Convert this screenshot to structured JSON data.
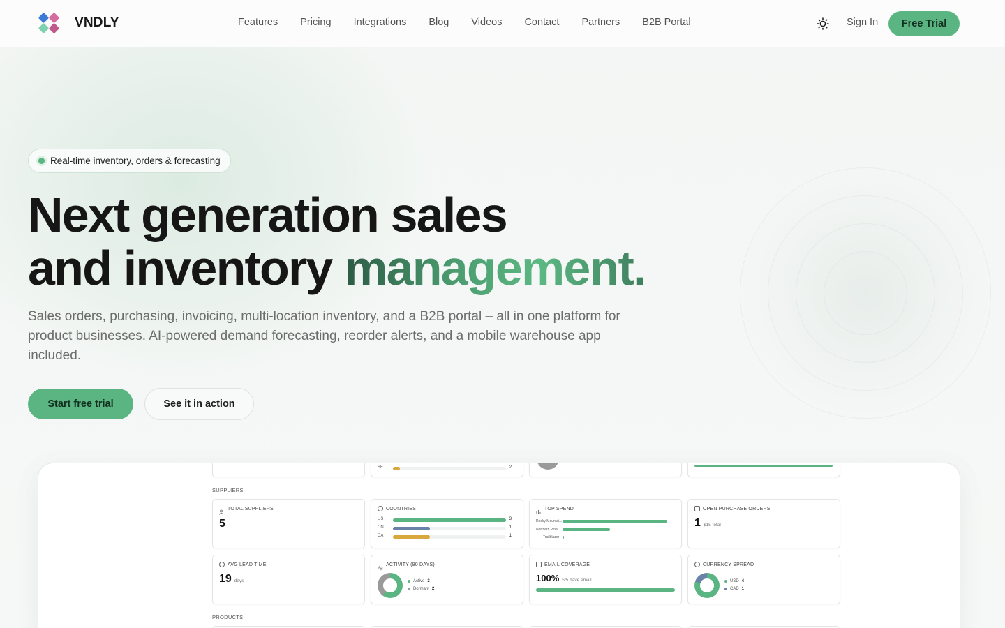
{
  "nav": {
    "brand": "VNDLY",
    "links": [
      "Features",
      "Pricing",
      "Integrations",
      "Blog",
      "Videos",
      "Contact",
      "Partners",
      "B2B Portal"
    ],
    "sign_in": "Sign In",
    "free_trial": "Free Trial",
    "theme_icon": "sun-icon"
  },
  "hero": {
    "badge": "Real-time inventory, orders & forecasting",
    "headline_line1": "Next generation sales",
    "headline_line2_plain": "and inventory ",
    "headline_line2_accent": "management.",
    "subtitle": "Sales orders, purchasing, invoicing, multi-location inventory, and a B2B portal – all in one platform for product businesses. AI-powered demand forecasting, reorder alerts, and a mobile warehouse app included.",
    "cta_primary": "Start free trial",
    "cta_secondary": "See it in action"
  },
  "colors": {
    "accent": "#5bb582",
    "accent_dark": "#2d5a45",
    "bar_blue": "#6b82a8",
    "bar_amber": "#d9a83c",
    "muted_gray": "#9a9a9a"
  },
  "dashboard": {
    "top_partial": {
      "country_row": {
        "label": "SE",
        "value": "2",
        "fraction": 0.06,
        "color": "#d9a83c"
      }
    },
    "suppliers_label": "SUPPLIERS",
    "products_label": "PRODUCTS",
    "total_suppliers": {
      "title": "TOTAL SUPPLIERS",
      "value": "5"
    },
    "countries": {
      "title": "COUNTRIES",
      "rows": [
        {
          "label": "US",
          "value": "3",
          "fraction": 1.0,
          "color": "#5bb582"
        },
        {
          "label": "CN",
          "value": "1",
          "fraction": 0.33,
          "color": "#6b82a8"
        },
        {
          "label": "CA",
          "value": "1",
          "fraction": 0.33,
          "color": "#d9a83c"
        }
      ]
    },
    "top_spend": {
      "title": "TOP SPEND",
      "rows": [
        {
          "label": "Rocky Mountai...",
          "fraction": 1.0
        },
        {
          "label": "Northern Pine...",
          "fraction": 0.45
        },
        {
          "label": "Trailblazer",
          "fraction": 0.01
        }
      ]
    },
    "open_pos": {
      "title": "OPEN PURCHASE ORDERS",
      "value": "1",
      "note": "$15 total"
    },
    "avg_lead": {
      "title": "AVG LEAD TIME",
      "value": "19",
      "unit": "days"
    },
    "activity": {
      "title": "ACTIVITY (90 DAYS)",
      "items": [
        {
          "label": "Active",
          "value": "3",
          "color": "#5bb582"
        },
        {
          "label": "Dormant",
          "value": "2",
          "color": "#9a9a9a"
        }
      ]
    },
    "email_coverage": {
      "title": "EMAIL COVERAGE",
      "value": "100%",
      "note": "5/5 have email",
      "fraction": 1.0
    },
    "currency_spread": {
      "title": "CURRENCY SPREAD",
      "items": [
        {
          "label": "USD",
          "value": "4",
          "color": "#5bb582"
        },
        {
          "label": "CAD",
          "value": "1",
          "color": "#6b82a8"
        }
      ]
    }
  }
}
